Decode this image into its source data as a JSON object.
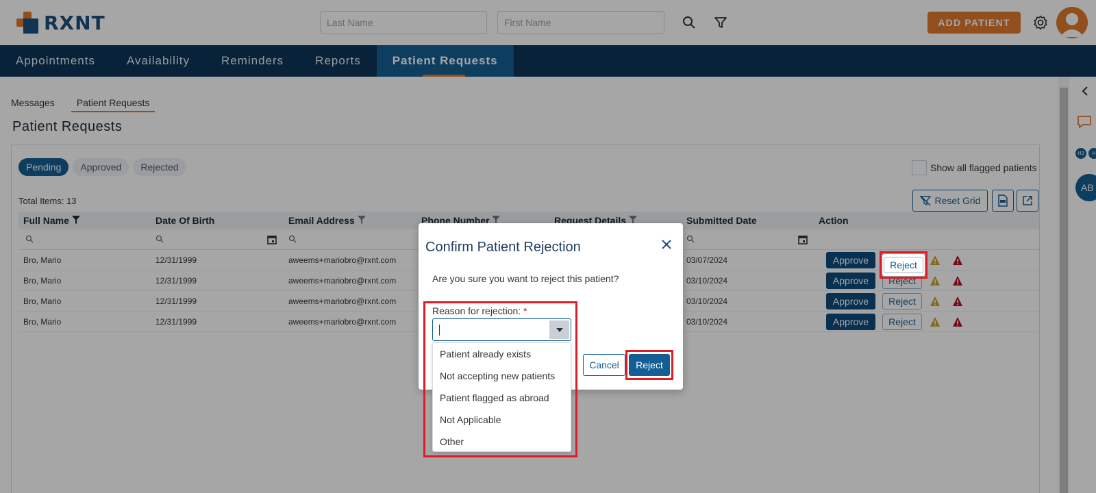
{
  "header": {
    "logo_text": "RXNT",
    "last_name_placeholder": "Last Name",
    "first_name_placeholder": "First Name",
    "add_patient_label": "ADD PATIENT"
  },
  "nav": {
    "items": [
      {
        "label": "Appointments"
      },
      {
        "label": "Availability"
      },
      {
        "label": "Reminders"
      },
      {
        "label": "Reports"
      },
      {
        "label": "Patient Requests"
      }
    ],
    "active": "Patient Requests"
  },
  "subtabs": [
    {
      "label": "Messages"
    },
    {
      "label": "Patient Requests"
    }
  ],
  "page_title": "Patient Requests",
  "filters": {
    "pills": [
      {
        "label": "Pending"
      },
      {
        "label": "Approved"
      },
      {
        "label": "Rejected"
      }
    ],
    "flag_label": "Show all flagged patients"
  },
  "grid": {
    "total_items": "Total Items: 13",
    "reset_grid_label": "Reset Grid",
    "columns": [
      "Full Name",
      "Date Of Birth",
      "Email Address",
      "Phone Number",
      "Request Details",
      "Submitted Date",
      "Action"
    ],
    "rows": [
      {
        "full_name": "Bro, Mario",
        "dob": "12/31/1999",
        "email": "aweems+mariobro@rxnt.com",
        "submitted": "03/07/2024"
      },
      {
        "full_name": "Bro, Mario",
        "dob": "12/31/1999",
        "email": "aweems+mariobro@rxnt.com",
        "submitted": "03/10/2024"
      },
      {
        "full_name": "Bro, Mario",
        "dob": "12/31/1999",
        "email": "aweems+mariobro@rxnt.com",
        "submitted": "03/10/2024"
      },
      {
        "full_name": "Bro, Mario",
        "dob": "12/31/1999",
        "email": "aweems+mariobro@rxnt.com",
        "submitted": "03/10/2024"
      }
    ],
    "approve_label": "Approve",
    "reject_label": "Reject"
  },
  "sidebar": {
    "badges": [
      "H3",
      "H"
    ],
    "avatar_initials": "AB"
  },
  "modal": {
    "title": "Confirm Patient Rejection",
    "message": "Are you sure you want to reject this patient?",
    "reason_label": "Reason for rejection:",
    "required_mark": "*",
    "options": [
      "Patient already exists",
      "Not accepting new patients",
      "Patient flagged as abroad",
      "Not Applicable",
      "Other"
    ],
    "cancel_label": "Cancel",
    "reject_label": "Reject"
  },
  "colors": {
    "brand_navy": "#0d3558",
    "brand_blue": "#155e93",
    "brand_orange": "#e07a2e",
    "annotation_red": "#e01b24"
  }
}
